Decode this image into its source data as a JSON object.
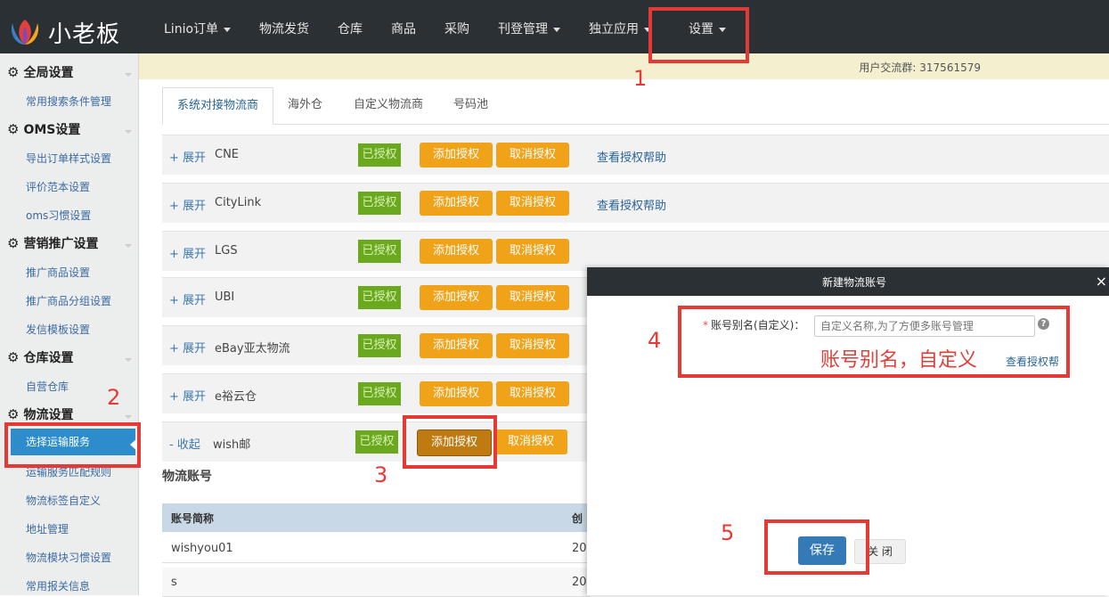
{
  "app": {
    "logo_text": "小老板"
  },
  "nav": [
    "Linio订单",
    "物流发货",
    "仓库",
    "商品",
    "采购",
    "刊登管理",
    "独立应用",
    "设置"
  ],
  "notice": "用户交流群: 317561579",
  "sidebar": {
    "groups": [
      {
        "title": "全局设置",
        "items": [
          "常用搜索条件管理"
        ]
      },
      {
        "title": "OMS设置",
        "items": [
          "导出订单样式设置",
          "评价范本设置",
          "oms习惯设置"
        ]
      },
      {
        "title": "营销推广设置",
        "items": [
          "推广商品设置",
          "推广商品分组设置",
          "发信模板设置"
        ]
      },
      {
        "title": "仓库设置",
        "items": [
          "自营仓库"
        ]
      },
      {
        "title": "物流设置",
        "items": [
          "选择运输服务",
          "运输服务匹配规则",
          "物流标签自定义",
          "地址管理",
          "物流模块习惯设置",
          "常用报关信息"
        ]
      }
    ]
  },
  "tabs": [
    "系统对接物流商",
    "海外仓",
    "自定义物流商",
    "号码池"
  ],
  "carriers": [
    {
      "toggle": "+ 展开",
      "name": "CNE",
      "status": "已授权",
      "add": "添加授权",
      "cancel": "取消授权",
      "help": "查看授权帮助"
    },
    {
      "toggle": "+ 展开",
      "name": "CityLink",
      "status": "已授权",
      "add": "添加授权",
      "cancel": "取消授权",
      "help": "查看授权帮助"
    },
    {
      "toggle": "+ 展开",
      "name": "LGS",
      "status": "已授权",
      "add": "添加授权",
      "cancel": "取消授权",
      "help": ""
    },
    {
      "toggle": "+ 展开",
      "name": "UBI",
      "status": "已授权",
      "add": "添加授权",
      "cancel": "取消授权",
      "help": ""
    },
    {
      "toggle": "+ 展开",
      "name": "eBay亚太物流",
      "status": "已授权",
      "add": "添加授权",
      "cancel": "取消授权",
      "help": ""
    },
    {
      "toggle": "+ 展开",
      "name": "e裕云仓",
      "status": "已授权",
      "add": "添加授权",
      "cancel": "取消授权",
      "help": ""
    },
    {
      "toggle": "- 收起",
      "name": "wish邮",
      "status": "已授权",
      "add": "添加授权",
      "cancel": "取消授权",
      "help": ""
    }
  ],
  "accounts": {
    "title": "物流账号",
    "headers": [
      "账号简称",
      "创"
    ],
    "rows": [
      [
        "wishyou01",
        "20"
      ],
      [
        "s",
        "20"
      ]
    ]
  },
  "modal": {
    "title": "新建物流账号",
    "close": "×",
    "label_required": "*",
    "label": "账号别名(自定义)：",
    "placeholder": "自定义名称,为了方便多账号管理",
    "help_icon": "?",
    "note": "账号别名，自定义",
    "help_link": "查看授权帮",
    "save": "保存",
    "close_btn": "关 闭"
  },
  "annotations": [
    "1",
    "2",
    "3",
    "4",
    "5"
  ]
}
